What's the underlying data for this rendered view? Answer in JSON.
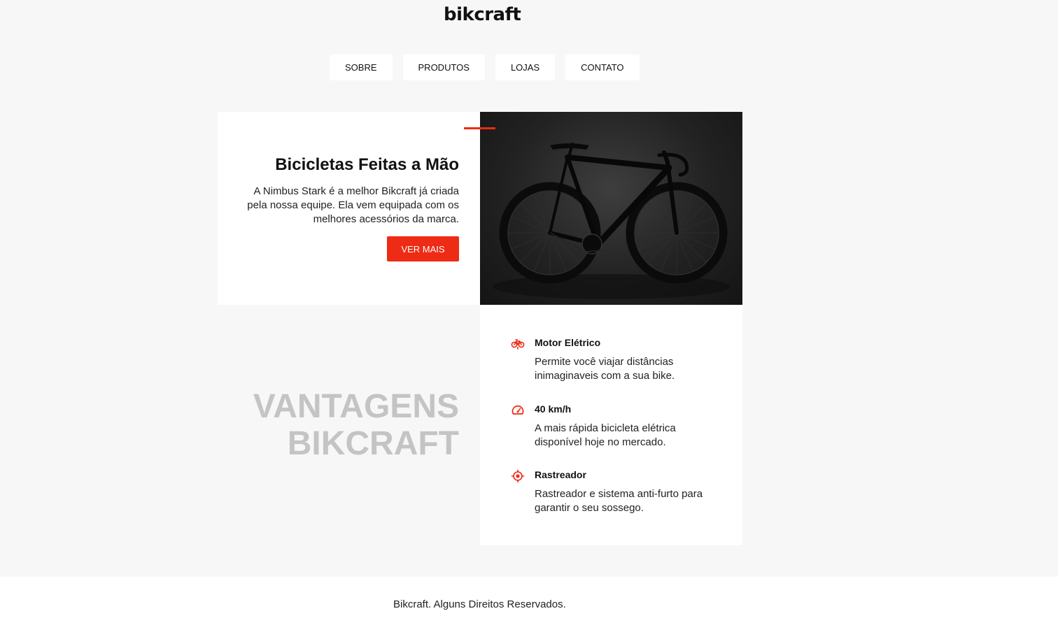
{
  "header": {
    "logo": "bikcraft",
    "nav": [
      "SOBRE",
      "PRODUTOS",
      "LOJAS",
      "CONTATO"
    ]
  },
  "hero": {
    "title": "Bicicletas Feitas a Mão",
    "description": "A Nimbus Stark é a melhor Bikcraft já criada pela nossa equipe. Ela vem equipada com os melhores acessórios da marca.",
    "button": "VER MAIS",
    "image": "black-road-bike-photo"
  },
  "vantagens": {
    "title_line1": "VANTAGENS",
    "title_line2": "BIKCRAFT",
    "items": [
      {
        "icon": "bike-icon",
        "title": "Motor Elétrico",
        "text": "Permite você viajar distâncias inimaginaveis com a sua bike."
      },
      {
        "icon": "speedometer-icon",
        "title": "40 km/h",
        "text": "A mais rápida bicicleta elétrica disponível hoje no mercado."
      },
      {
        "icon": "target-icon",
        "title": "Rastreador",
        "text": "Rastreador e sistema anti-furto para garantir o seu sossego."
      }
    ]
  },
  "footer": {
    "text": "Bikcraft. Alguns Direitos Reservados."
  },
  "colors": {
    "accent": "#ee2b14",
    "background": "#f7f7f7",
    "muted_title": "#c4c4c4"
  }
}
